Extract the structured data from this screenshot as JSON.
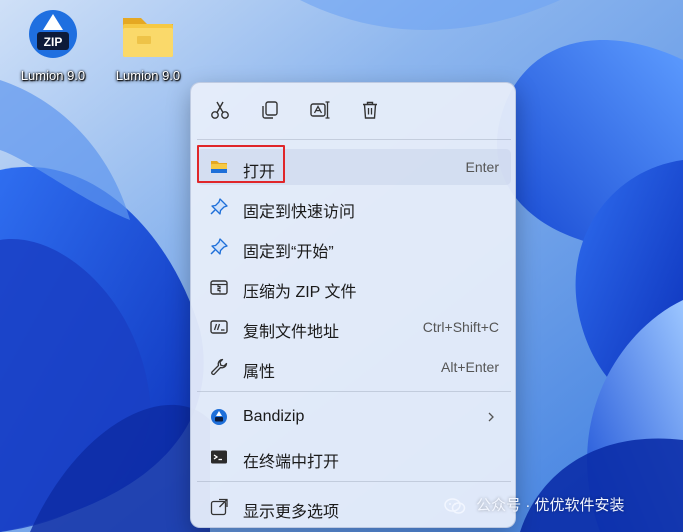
{
  "desktop": {
    "icons": [
      {
        "label": "Lumion 9.0",
        "icon": "zip-archive-icon",
        "badge": "ZIP"
      },
      {
        "label": "Lumion 9.0",
        "icon": "folder-icon"
      }
    ]
  },
  "context_menu": {
    "toolbar": [
      {
        "name": "cut",
        "icon": "scissors-icon"
      },
      {
        "name": "copy",
        "icon": "copy-icon"
      },
      {
        "name": "rename",
        "icon": "rename-icon"
      },
      {
        "name": "delete",
        "icon": "trash-icon"
      }
    ],
    "items": [
      {
        "label": "打开",
        "shortcut": "Enter",
        "icon": "folder-open-icon"
      },
      {
        "label": "固定到快速访问",
        "icon": "pin-icon"
      },
      {
        "label": "固定到“开始”",
        "icon": "pin-icon"
      },
      {
        "label": "压缩为 ZIP 文件",
        "icon": "zip-folder-icon"
      },
      {
        "label": "复制文件地址",
        "shortcut": "Ctrl+Shift+C",
        "icon": "path-icon"
      },
      {
        "label": "属性",
        "shortcut": "Alt+Enter",
        "icon": "wrench-icon"
      },
      {
        "label": "Bandizip",
        "icon": "bandizip-icon",
        "has_submenu": true
      },
      {
        "label": "在终端中打开",
        "icon": "terminal-icon"
      },
      {
        "label": "显示更多选项",
        "icon": "more-options-icon"
      }
    ]
  },
  "watermark": {
    "text": "公众号 · 优优软件安装"
  },
  "colors": {
    "accent": "#1e6fd9",
    "highlight_border": "#e0262a",
    "folder_yellow": "#f3c23c"
  }
}
